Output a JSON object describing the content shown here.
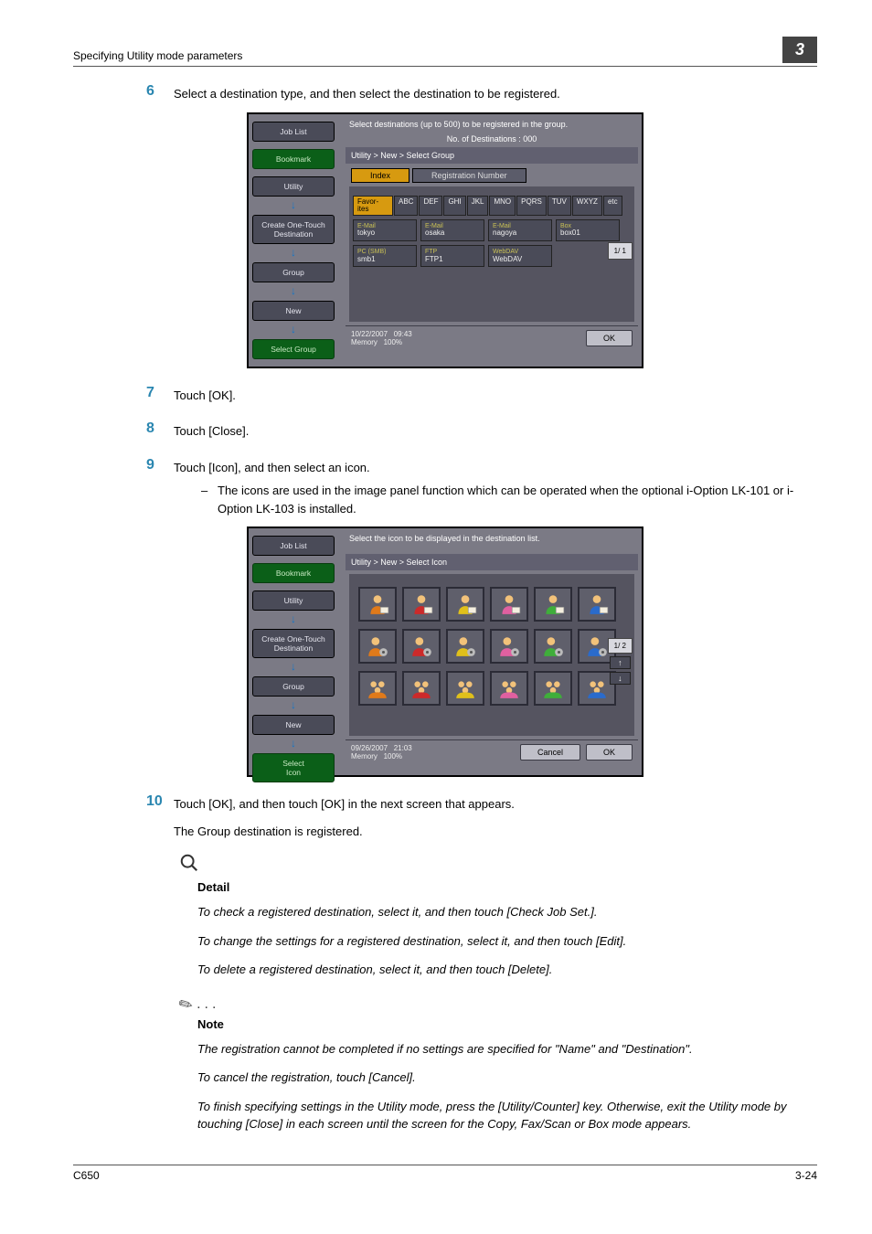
{
  "header": {
    "section_title": "Specifying Utility mode parameters",
    "chapter_number": "3"
  },
  "steps": {
    "s6": {
      "num": "6",
      "text": "Select a destination type, and then select the destination to be registered."
    },
    "s7": {
      "num": "7",
      "text": "Touch [OK]."
    },
    "s8": {
      "num": "8",
      "text": "Touch [Close]."
    },
    "s9": {
      "num": "9",
      "text": "Touch [Icon], and then select an icon."
    },
    "s9b": {
      "dash": "–",
      "text": "The icons are used in the image panel function which can be operated when the optional i-Option LK-101 or i-Option LK-103 is installed."
    },
    "s10": {
      "num": "10",
      "text1": "Touch [OK], and then touch [OK] in the next screen that appears.",
      "text2": "The Group destination is registered."
    }
  },
  "panel1": {
    "title": "Select destinations (up to 500) to be registered in the group.",
    "subtitle": "No. of Destinations :   000",
    "breadcrumb": "Utility > New > Select Group",
    "tabs": {
      "index": "Index",
      "regnum": "Registration Number"
    },
    "sidebar": [
      "Job List",
      "Bookmark",
      "Utility",
      "Create One-Touch Destination",
      "Group",
      "New",
      "Select Group"
    ],
    "index_row": [
      "Favor-\nites",
      "ABC",
      "DEF",
      "GHI",
      "JKL",
      "MNO",
      "PQRS",
      "TUV",
      "WXYZ",
      "etc"
    ],
    "dest_row1": [
      {
        "kind": "E-Mail",
        "name": "tokyo"
      },
      {
        "kind": "E-Mail",
        "name": "osaka"
      },
      {
        "kind": "E-Mail",
        "name": "nagoya"
      },
      {
        "kind": "Box",
        "name": "box01"
      }
    ],
    "dest_row2": [
      {
        "kind": "PC (SMB)",
        "name": "smb1"
      },
      {
        "kind": "FTP",
        "name": "FTP1"
      },
      {
        "kind": "WebDAV",
        "name": "WebDAV"
      }
    ],
    "pager": "1/ 1",
    "footer": {
      "date": "10/22/2007",
      "time": "09:43",
      "mem": "Memory",
      "mempct": "100%",
      "ok": "OK"
    }
  },
  "panel2": {
    "title": "Select the icon to be displayed in the destination list.",
    "breadcrumb": "Utility > New > Select Icon",
    "sidebar": [
      "Job List",
      "Bookmark",
      "Utility",
      "Create One-Touch Destination",
      "Group",
      "New",
      "Select\nIcon"
    ],
    "pager": "1/ 2",
    "footer": {
      "date": "09/26/2007",
      "time": "21:03",
      "mem": "Memory",
      "mempct": "100%",
      "cancel": "Cancel",
      "ok": "OK"
    }
  },
  "detail": {
    "head": "Detail",
    "p1": "To check a registered destination, select it, and then touch [Check Job Set.].",
    "p2": "To change the settings for a registered destination, select it, and then touch [Edit].",
    "p3": "To delete a registered destination, select it, and then touch [Delete]."
  },
  "note": {
    "head": "Note",
    "p1": "The registration cannot be completed if no settings are specified for \"Name\" and \"Destination\".",
    "p2": "To cancel the registration, touch [Cancel].",
    "p3": "To finish specifying settings in the Utility mode, press the [Utility/Counter] key. Otherwise, exit the Utility mode by touching [Close] in each screen until the screen for the Copy, Fax/Scan or Box mode appears."
  },
  "footer": {
    "model": "C650",
    "page": "3-24"
  }
}
